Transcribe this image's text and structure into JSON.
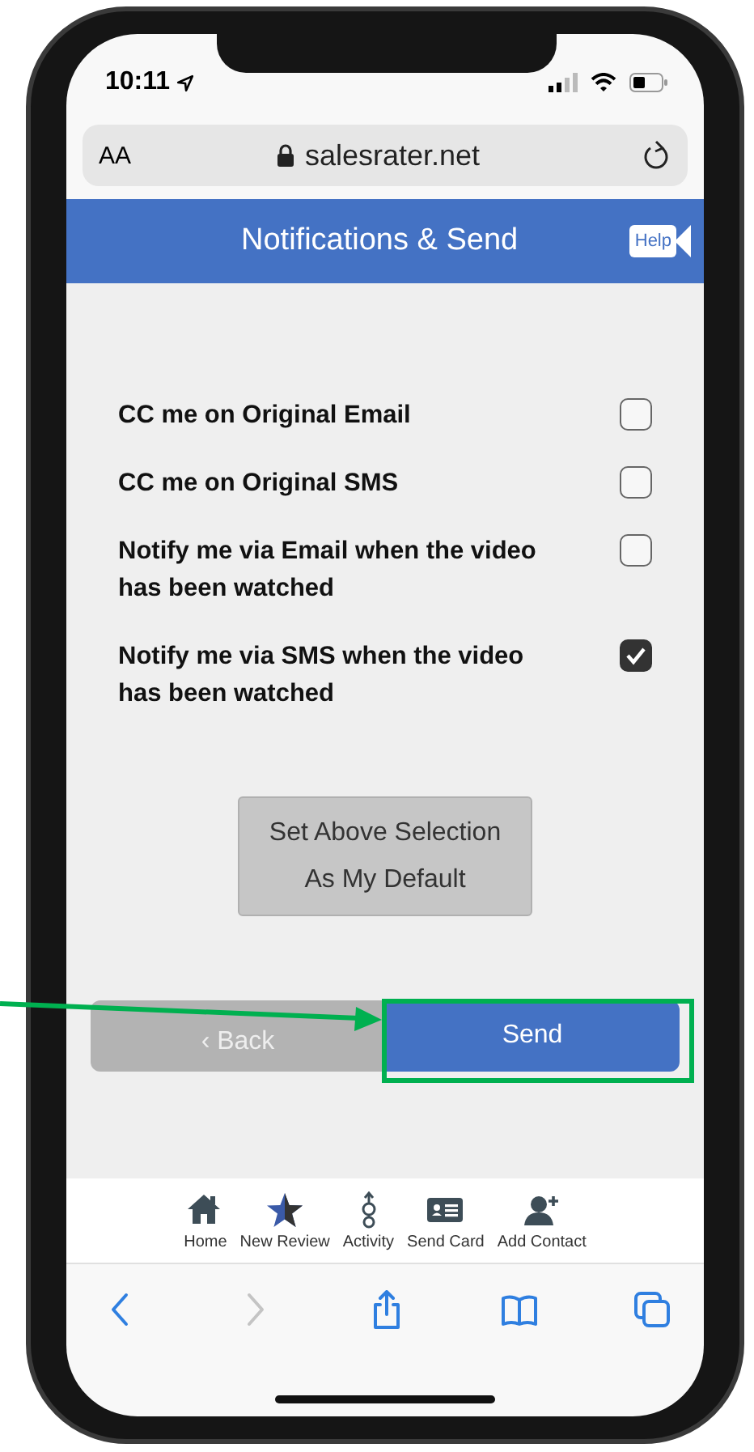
{
  "status_bar": {
    "time": "10:11"
  },
  "address_bar": {
    "text_size": "AA",
    "url": "salesrater.net"
  },
  "header": {
    "title": "Notifications & Send",
    "help": "Help"
  },
  "options": [
    {
      "label": "CC me on Original Email",
      "checked": false
    },
    {
      "label": "CC me on Original SMS",
      "checked": false
    },
    {
      "label": "Notify me via Email when the video has been watched",
      "checked": false
    },
    {
      "label": "Notify me via SMS when the video has been watched",
      "checked": true
    }
  ],
  "default_button": "Set Above Selection As My Default",
  "back_button": "‹ Back",
  "send_button": "Send",
  "tab_bar": [
    {
      "kind": "home",
      "label": "Home"
    },
    {
      "kind": "star",
      "label": "New Review"
    },
    {
      "kind": "activity",
      "label": "Activity"
    },
    {
      "kind": "card",
      "label": "Send Card"
    },
    {
      "kind": "contact",
      "label": "Add Contact"
    }
  ],
  "browser_toolbar": [
    {
      "kind": "back",
      "disabled": false
    },
    {
      "kind": "forward",
      "disabled": true
    },
    {
      "kind": "share",
      "disabled": false
    },
    {
      "kind": "bookmarks",
      "disabled": false
    },
    {
      "kind": "tabs",
      "disabled": false
    }
  ]
}
